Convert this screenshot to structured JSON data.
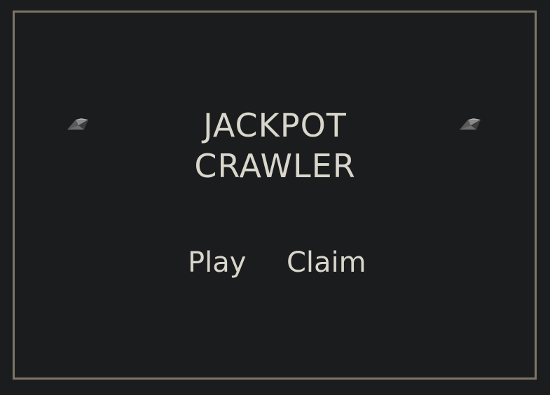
{
  "title": {
    "line1": "JACKPOT",
    "line2": "CRAWLER"
  },
  "menu": {
    "play_label": "Play",
    "claim_label": "Claim"
  },
  "decorations": {
    "left_icon": "gem-icon",
    "right_icon": "gem-icon"
  },
  "colors": {
    "background": "#1b1c1d",
    "frame_border": "#7d7668",
    "text": "#d9d6cc"
  }
}
